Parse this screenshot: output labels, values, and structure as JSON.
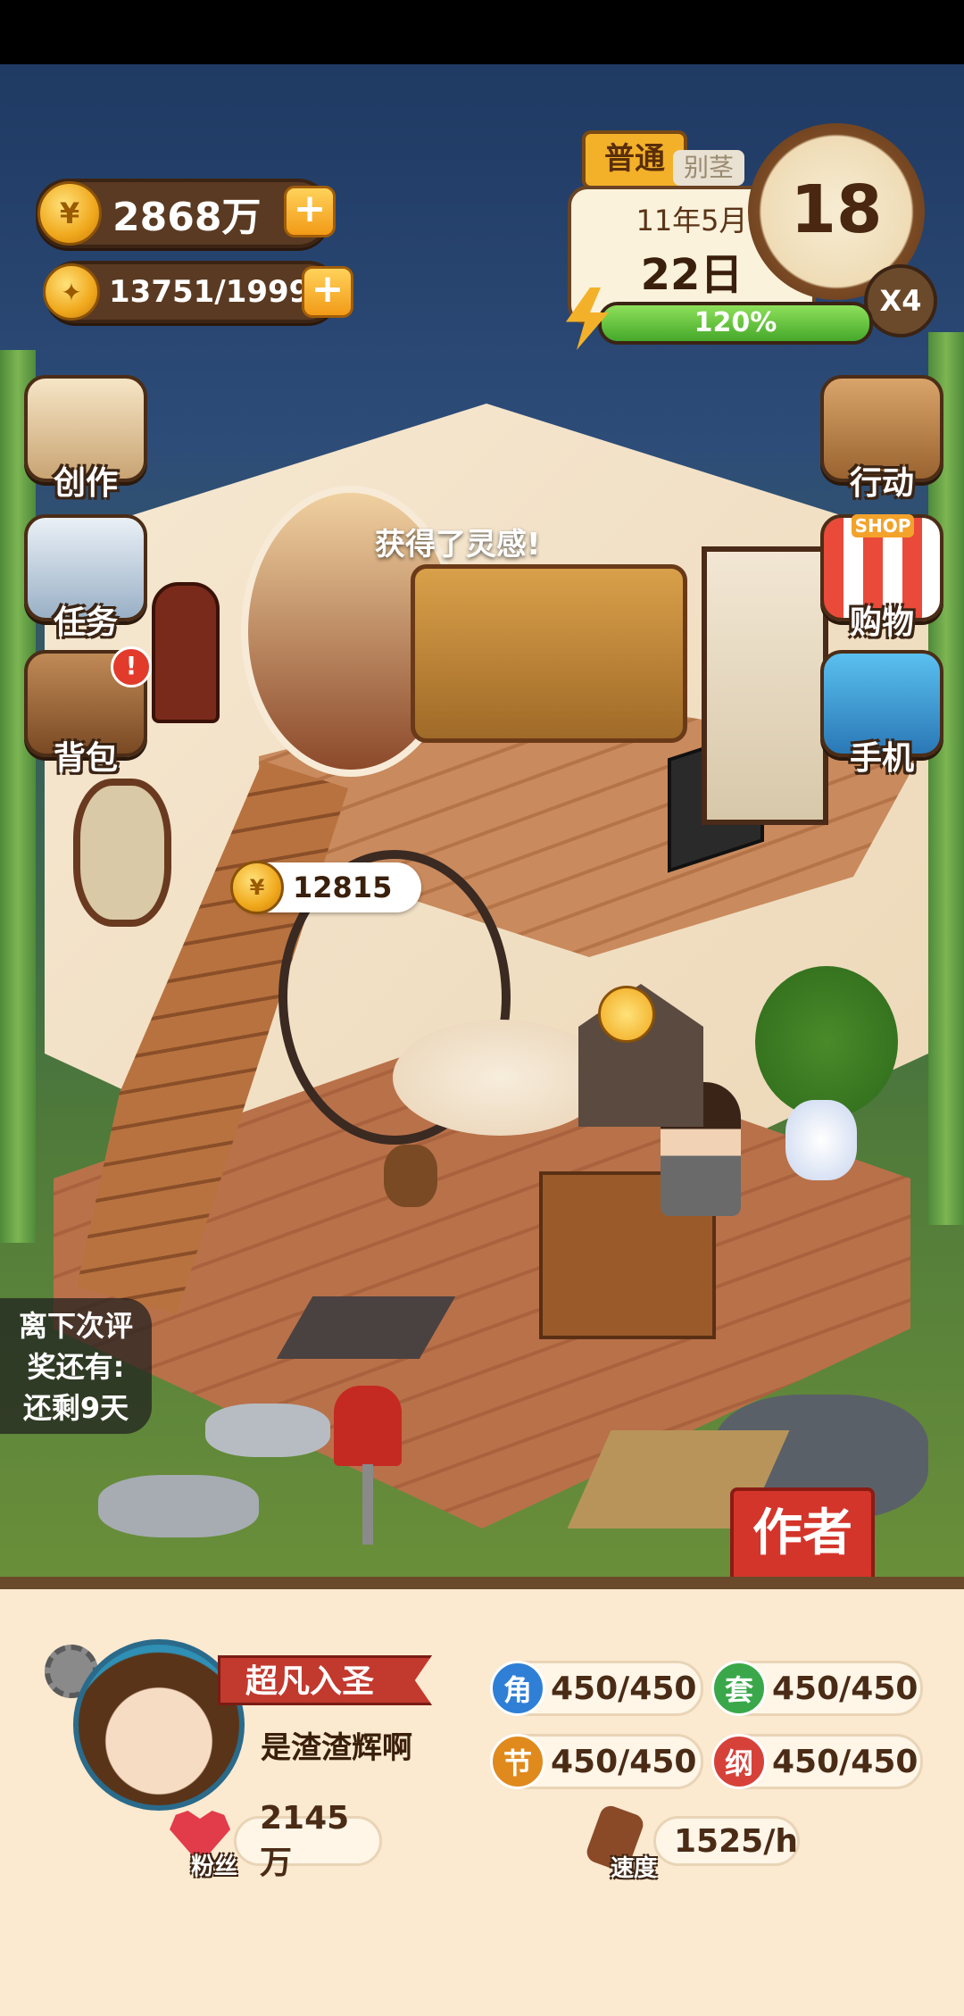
{
  "resources": {
    "coins": "2868万",
    "energy": "13751/19999"
  },
  "calendar": {
    "mode": "普通",
    "mode_tab2": "别茎",
    "month": "11年5月",
    "day": "22日",
    "progress_label": "120%",
    "progress_value": 1.0,
    "clock_value": "18",
    "speed": "X4"
  },
  "left_menu": [
    {
      "label": "创作",
      "icon": "book-icon"
    },
    {
      "label": "任务",
      "icon": "clipboard-icon"
    },
    {
      "label": "背包",
      "icon": "backpack-icon"
    }
  ],
  "right_menu": [
    {
      "label": "行动",
      "icon": "door-icon"
    },
    {
      "label": "购物",
      "icon": "shop-icon"
    },
    {
      "label": "手机",
      "icon": "phone-icon"
    }
  ],
  "scene": {
    "toast": "获得了灵感!",
    "coin_bubble": "12815",
    "shop_sign": "SHOP"
  },
  "review_countdown": {
    "line1": "离下次评",
    "line2": "奖还有:",
    "line3": "还剩9天"
  },
  "author_button": "作者",
  "profile": {
    "title": "超凡入圣",
    "name": "是渣渣辉啊",
    "fans_label": "粉丝",
    "fans_value": "2145万",
    "speed_label": "速度",
    "speed_value": "1525/h"
  },
  "stats": [
    {
      "badge": "角",
      "value": "450/450",
      "color": "#2f7fd6"
    },
    {
      "badge": "套",
      "value": "450/450",
      "color": "#3aa84a"
    },
    {
      "badge": "节",
      "value": "450/450",
      "color": "#e08a1e"
    },
    {
      "badge": "纲",
      "value": "450/450",
      "color": "#d6423a"
    }
  ]
}
